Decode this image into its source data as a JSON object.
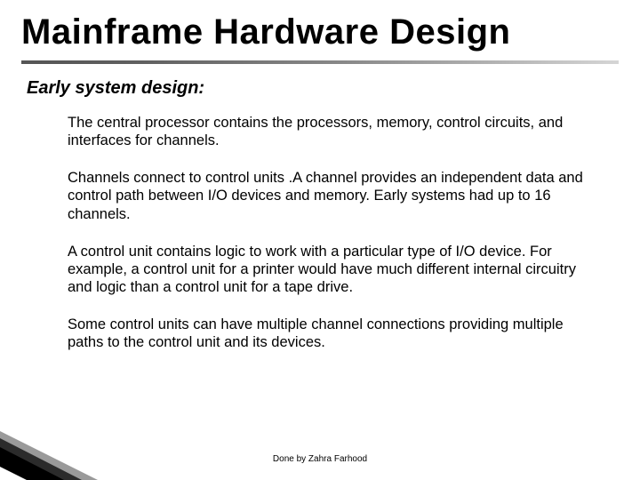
{
  "title": "Mainframe Hardware Design",
  "subheading": "Early  system design:",
  "paragraphs": {
    "p1": "The central processor contains the processors, memory, control circuits, and interfaces for channels.",
    "p2": "Channels connect to control units .A channel provides an independent data and control path between I/O devices and memory. Early systems had up to 16 channels.",
    "p3": "A control unit contains logic to work with a particular type of I/O device. For example, a control unit for a printer would have much different internal circuitry and logic than a control unit for a tape drive.",
    "p4": "Some control units can have multiple channel connections providing multiple paths to the control unit and its devices."
  },
  "footer": "Done by Zahra Farhood"
}
